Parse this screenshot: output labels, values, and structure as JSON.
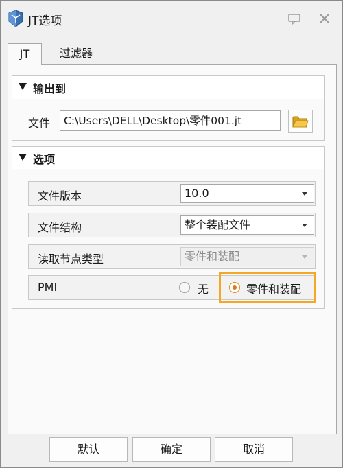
{
  "window": {
    "title": "JT选项"
  },
  "tabs": [
    {
      "label": "JT"
    },
    {
      "label": "过滤器"
    }
  ],
  "output_section": {
    "title": "输出到",
    "file_label": "文件",
    "file_value": "C:\\Users\\DELL\\Desktop\\零件001.jt"
  },
  "options_section": {
    "title": "选项",
    "rows": [
      {
        "label": "文件版本",
        "value": "10.0"
      },
      {
        "label": "文件结构",
        "value": "整个装配文件"
      },
      {
        "label": "读取节点类型",
        "value": "零件和装配"
      }
    ],
    "pmi": {
      "label": "PMI",
      "option_none": "无",
      "option_parts": "零件和装配",
      "selected": "零件和装配"
    }
  },
  "footer": {
    "default_label": "默认",
    "ok_label": "确定",
    "cancel_label": "取消"
  },
  "colors": {
    "highlight": "#f5a623",
    "radio_selected": "#e0781a"
  }
}
